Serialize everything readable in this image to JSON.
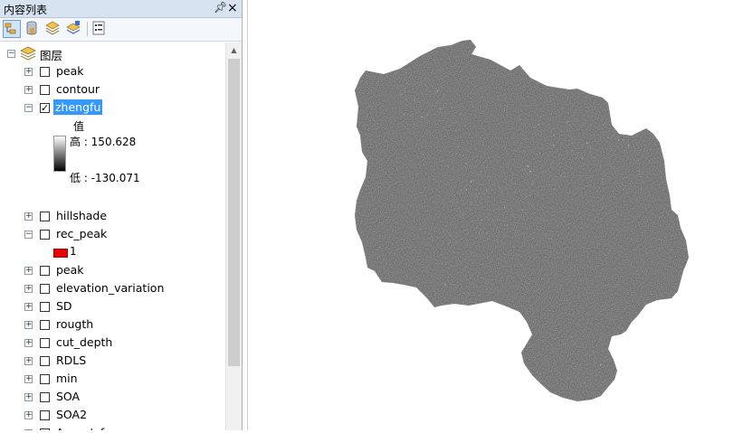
{
  "toc": {
    "title": "内容列表",
    "pin_glyph": "ᆛ",
    "close_glyph": "×",
    "toolbar": [
      {
        "name": "list-by-drawing-order-icon",
        "active": true
      },
      {
        "name": "list-by-source-icon",
        "active": false
      },
      {
        "name": "list-by-visibility-icon",
        "active": false
      },
      {
        "name": "list-by-selection-icon",
        "active": false
      },
      {
        "name": "options-icon",
        "active": false
      }
    ],
    "root_label": "图层",
    "layers": [
      {
        "label": "peak",
        "expanded": false,
        "checked": false
      },
      {
        "label": "contour",
        "expanded": false,
        "checked": false
      },
      {
        "label": "zhengfu",
        "expanded": true,
        "checked": true,
        "selected": true
      },
      {
        "label": "hillshade",
        "expanded": false,
        "checked": false
      },
      {
        "label": "rec_peak",
        "expanded": true,
        "checked": false
      },
      {
        "label": "peak",
        "expanded": false,
        "checked": false
      },
      {
        "label": "elevation_variation",
        "expanded": false,
        "checked": false
      },
      {
        "label": "SD",
        "expanded": false,
        "checked": false
      },
      {
        "label": "rougth",
        "expanded": false,
        "checked": false
      },
      {
        "label": "cut_depth",
        "expanded": false,
        "checked": false
      },
      {
        "label": "RDLS",
        "expanded": false,
        "checked": false
      },
      {
        "label": "min",
        "expanded": false,
        "checked": false
      },
      {
        "label": "SOA",
        "expanded": false,
        "checked": false
      },
      {
        "label": "SOA2",
        "expanded": false,
        "checked": false
      },
      {
        "label": "Aspect_f",
        "expanded": false,
        "checked": false
      }
    ],
    "zhengfu_legend": {
      "field": "值",
      "high": "高 : 150.628",
      "low": "低 : -130.071"
    },
    "rec_peak_legend": {
      "value": "1",
      "color": "#e60000"
    }
  },
  "map": {
    "background": "#ffffff",
    "raster_fill": "#555555"
  }
}
